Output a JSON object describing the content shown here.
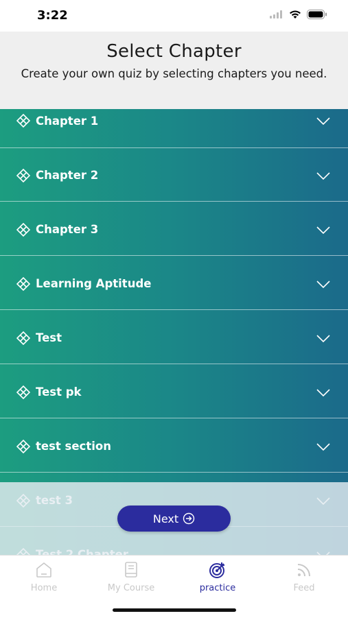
{
  "status": {
    "time": "3:22"
  },
  "header": {
    "title": "Select Chapter",
    "subtitle": "Create your own quiz by selecting chapters you need."
  },
  "chapters": [
    {
      "label": "Chapter 1"
    },
    {
      "label": "Chapter 2"
    },
    {
      "label": "Chapter 3"
    },
    {
      "label": "Learning Aptitude"
    },
    {
      "label": "Test"
    },
    {
      "label": "Test pk"
    },
    {
      "label": "test section"
    },
    {
      "label": "test 3"
    },
    {
      "label": "Test 2 Chapter"
    }
  ],
  "next_button": {
    "label": "Next"
  },
  "tabs": [
    {
      "label": "Home",
      "icon": "home-icon"
    },
    {
      "label": "My Course",
      "icon": "book-icon"
    },
    {
      "label": "practice",
      "icon": "target-icon",
      "active": true
    },
    {
      "label": "Feed",
      "icon": "rss-icon"
    }
  ],
  "colors": {
    "accent": "#2b2c9e",
    "gradient_start": "#1c9d80",
    "gradient_end": "#1b6a8a"
  }
}
